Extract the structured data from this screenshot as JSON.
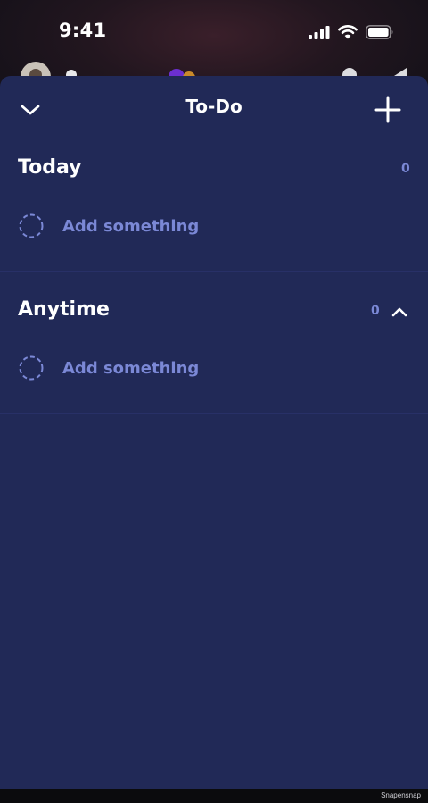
{
  "status_bar": {
    "time": "9:41"
  },
  "header": {
    "title": "To-Do"
  },
  "sections": [
    {
      "title": "Today",
      "count": "0",
      "add_label": "Add something"
    },
    {
      "title": "Anytime",
      "count": "0",
      "add_label": "Add something"
    }
  ],
  "footer": {
    "watermark": "Snapensnap"
  },
  "colors": {
    "sheet": "#212957",
    "accent": "#7b88d6",
    "divider": "#283067"
  }
}
